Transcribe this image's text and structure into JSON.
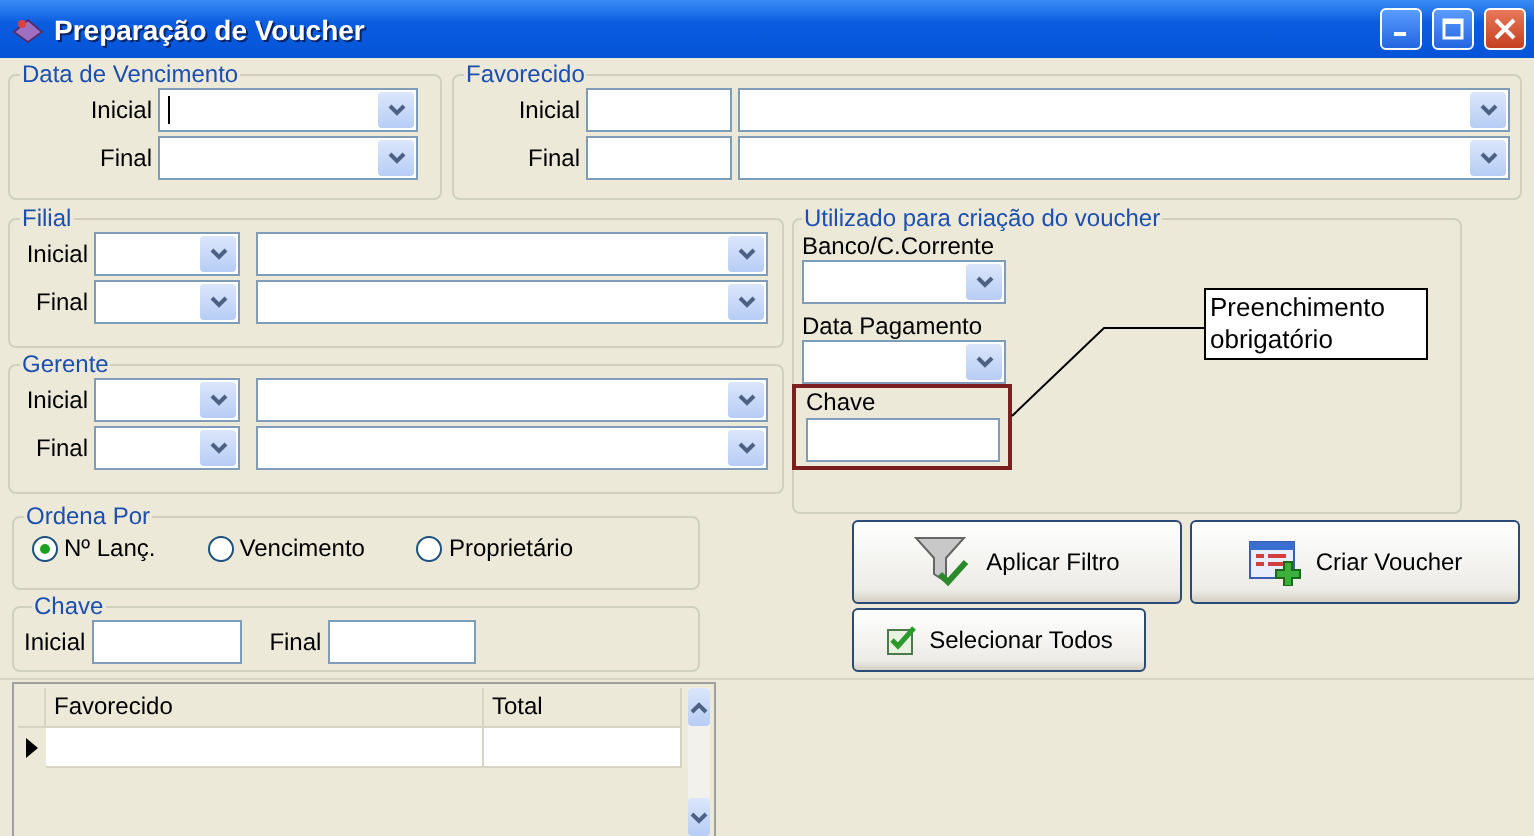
{
  "window": {
    "title": "Preparação de Voucher"
  },
  "due_date": {
    "legend": "Data de Vencimento",
    "rows": [
      {
        "label": "Inicial",
        "focused": true
      },
      {
        "label": "Final",
        "focused": false
      }
    ]
  },
  "payee": {
    "legend": "Favorecido",
    "rows": [
      {
        "label": "Inicial"
      },
      {
        "label": "Final"
      }
    ]
  },
  "branch": {
    "legend": "Filial",
    "rows": [
      {
        "label": "Inicial"
      },
      {
        "label": "Final"
      }
    ]
  },
  "manager": {
    "legend": "Gerente",
    "rows": [
      {
        "label": "Inicial"
      },
      {
        "label": "Final"
      }
    ]
  },
  "voucher": {
    "legend": "Utilizado para criação do voucher",
    "bank_label": "Banco/C.Corrente",
    "payment_date_label": "Data Pagamento",
    "key_label": "Chave",
    "callout": "Preenchimento obrigatório"
  },
  "sort": {
    "legend": "Ordena Por",
    "options": [
      {
        "label": "Nº Lanç.",
        "selected": true
      },
      {
        "label": "Vencimento",
        "selected": false
      },
      {
        "label": "Proprietário",
        "selected": false
      }
    ]
  },
  "key": {
    "legend": "Chave",
    "initial_label": "Inicial",
    "final_label": "Final"
  },
  "buttons": [
    {
      "label": "Aplicar Filtro",
      "kind": "filter"
    },
    {
      "label": "Criar Voucher",
      "kind": "create"
    },
    {
      "label": "Selecionar Todos",
      "kind": "select-all"
    }
  ],
  "grid": {
    "columns": [
      "Favorecido",
      "Total"
    ]
  }
}
